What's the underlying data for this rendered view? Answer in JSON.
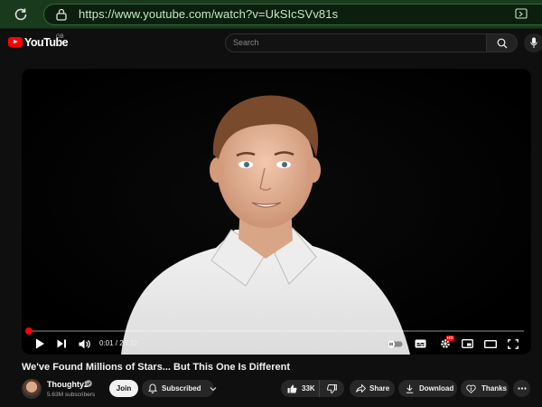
{
  "browser": {
    "url_host": "https://www.youtube.com",
    "url_path": "/watch?v=UkSIcSVv81s"
  },
  "header": {
    "logo_text": "YouTube",
    "region": "GB",
    "search_placeholder": "Search"
  },
  "player": {
    "current_time": "0:01",
    "duration": "20:32",
    "time_display": "0:01 / 20:32",
    "progress_fraction": 0.001,
    "hd_badge": "HD"
  },
  "video": {
    "title": "We've Found Millions of Stars... But This One Is Different"
  },
  "channel": {
    "name": "Thoughty2",
    "subscribers": "5.63M subscribers"
  },
  "actions": {
    "join": "Join",
    "subscribed": "Subscribed",
    "likes": "33K",
    "share": "Share",
    "download": "Download",
    "thanks": "Thanks"
  },
  "colors": {
    "accent": "#ff0000",
    "browser_bar": "#1a3a1e",
    "background": "#0f0f0f"
  }
}
